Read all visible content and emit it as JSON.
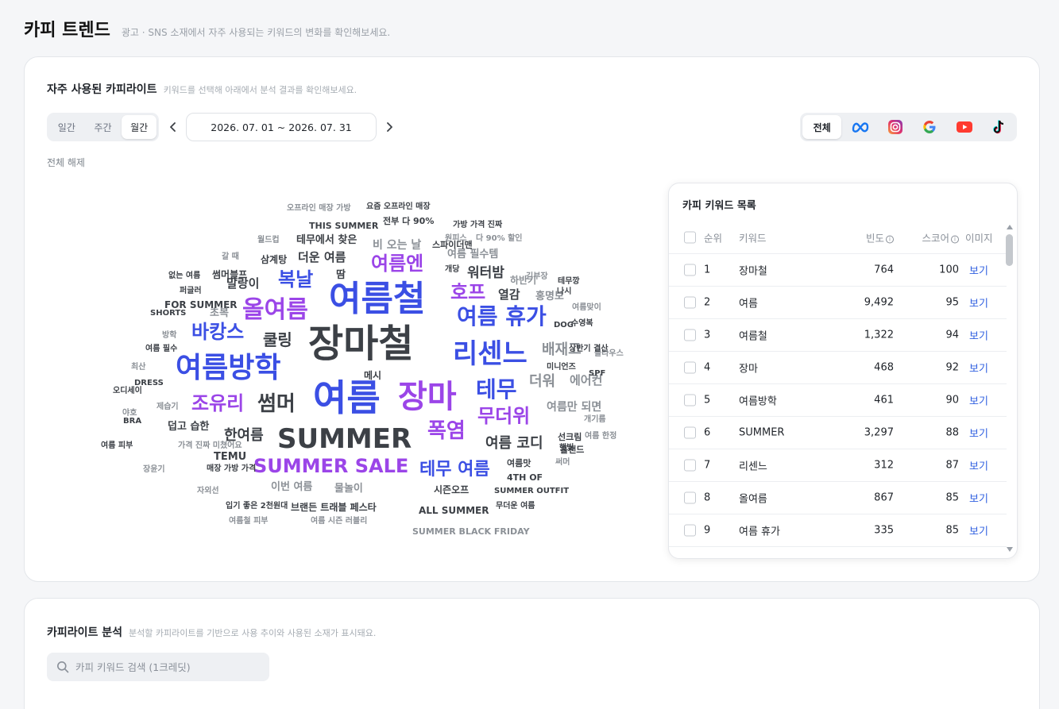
{
  "page": {
    "title": "카피 트렌드",
    "subtitle": "광고 · SNS 소재에서 자주 사용되는 키워드의 변화를 확인해보세요."
  },
  "frequent": {
    "title": "자주 사용된 카피라이트",
    "desc": "키워드를 선택해 아래에서 분석 결과를 확인해보세요.",
    "periods": [
      "일간",
      "주간",
      "월간"
    ],
    "active_period": "월간",
    "date_range": "2026. 07. 01 ~ 2026. 07. 31",
    "platforms": {
      "all": "전체",
      "icons": [
        "meta-icon",
        "instagram-icon",
        "google-icon",
        "youtube-icon",
        "tiktok-icon"
      ]
    },
    "clear_label": "전체 해제"
  },
  "colors": {
    "blue": "#3b4fe4",
    "purple": "#9b45e8",
    "dark": "#3c4046",
    "gray": "#8b9096",
    "accent": "#2f5fe0"
  },
  "wordcloud": [
    {
      "t": "장마철",
      "c": "dark"
    },
    {
      "t": "여름철",
      "c": "blue"
    },
    {
      "t": "여름",
      "c": "blue"
    },
    {
      "t": "장마",
      "c": "purple"
    },
    {
      "t": "여름방학",
      "c": "blue"
    },
    {
      "t": "SUMMER",
      "c": "dark"
    },
    {
      "t": "리센느",
      "c": "blue"
    },
    {
      "t": "올여름",
      "c": "purple"
    },
    {
      "t": "여름 휴가",
      "c": "blue"
    },
    {
      "t": "SUMMER SALE",
      "c": "purple"
    },
    {
      "t": "여름엔",
      "c": "purple"
    },
    {
      "t": "테무",
      "c": "blue"
    },
    {
      "t": "복날",
      "c": "blue"
    },
    {
      "t": "호프",
      "c": "purple"
    },
    {
      "t": "바캉스",
      "c": "blue"
    },
    {
      "t": "썸머",
      "c": "dark"
    },
    {
      "t": "조유리",
      "c": "purple"
    },
    {
      "t": "무더위",
      "c": "purple"
    },
    {
      "t": "폭염",
      "c": "purple"
    },
    {
      "t": "테무 여름",
      "c": "blue"
    },
    {
      "t": "여름 코디",
      "c": "dark"
    },
    {
      "t": "한여름",
      "c": "dark"
    },
    {
      "t": "쿨링",
      "c": "dark"
    },
    {
      "t": "배재고",
      "c": "gray"
    },
    {
      "t": "더워",
      "c": "gray"
    },
    {
      "t": "에어컨",
      "c": "gray"
    },
    {
      "t": "워터밤",
      "c": "dark"
    },
    {
      "t": "열감",
      "c": "dark"
    },
    {
      "t": "말랑이",
      "c": "dark"
    },
    {
      "t": "더운 여름",
      "c": "dark"
    },
    {
      "t": "비 오는 날",
      "c": "gray"
    },
    {
      "t": "여름만 되면",
      "c": "gray"
    },
    {
      "t": "홍명보",
      "c": "gray"
    },
    {
      "t": "여름 필수템",
      "c": "gray"
    },
    {
      "t": "테무에서 찾은",
      "c": "dark"
    },
    {
      "t": "덥고 습한",
      "c": "dark"
    },
    {
      "t": "물놀이",
      "c": "gray"
    },
    {
      "t": "이번 여름",
      "c": "gray"
    },
    {
      "t": "브랜든 트래블 페스타",
      "c": "dark"
    },
    {
      "t": "ALL SUMMER",
      "c": "dark"
    },
    {
      "t": "TEMU",
      "c": "dark"
    },
    {
      "t": "FOR SUMMER",
      "c": "dark"
    },
    {
      "t": "초복",
      "c": "gray"
    },
    {
      "t": "삼계탕",
      "c": "dark"
    },
    {
      "t": "썸머블프",
      "c": "dark"
    },
    {
      "t": "땀",
      "c": "dark"
    },
    {
      "t": "메시",
      "c": "dark"
    },
    {
      "t": "하반기",
      "c": "gray"
    },
    {
      "t": "시즌오프",
      "c": "dark"
    },
    {
      "t": "선크림",
      "c": "dark"
    },
    {
      "t": "홀랜드",
      "c": "dark"
    },
    {
      "t": "4TH OF",
      "c": "dark"
    },
    {
      "t": "여름맛",
      "c": "dark"
    },
    {
      "t": "스파이더맨",
      "c": "dark"
    },
    {
      "t": "전부 다 90%",
      "c": "dark"
    },
    {
      "t": "THIS SUMMER",
      "c": "dark"
    },
    {
      "t": "요즘 오프라인 매장",
      "c": "dark"
    },
    {
      "t": "오프라인 매장 가방",
      "c": "gray"
    },
    {
      "t": "가방 가격 진짜",
      "c": "dark"
    },
    {
      "t": "원피스",
      "c": "gray"
    },
    {
      "t": "다 90% 할인",
      "c": "gray"
    },
    {
      "t": "월드컵",
      "c": "gray"
    },
    {
      "t": "갈 때",
      "c": "gray"
    },
    {
      "t": "없는 여름",
      "c": "dark"
    },
    {
      "t": "퍼글러",
      "c": "dark"
    },
    {
      "t": "SHORTS",
      "c": "dark"
    },
    {
      "t": "방학",
      "c": "gray"
    },
    {
      "t": "여름 필수",
      "c": "dark"
    },
    {
      "t": "최산",
      "c": "gray"
    },
    {
      "t": "DRESS",
      "c": "dark"
    },
    {
      "t": "오디세이",
      "c": "dark"
    },
    {
      "t": "야호",
      "c": "gray"
    },
    {
      "t": "제습기",
      "c": "gray"
    },
    {
      "t": "BRA",
      "c": "dark"
    },
    {
      "t": "여름 피부",
      "c": "dark"
    },
    {
      "t": "가격 진짜 미쳤어요",
      "c": "gray"
    },
    {
      "t": "장윤기",
      "c": "gray"
    },
    {
      "t": "매장 가방 가격",
      "c": "dark"
    },
    {
      "t": "자외선",
      "c": "gray"
    },
    {
      "t": "입기 좋은 2천원대",
      "c": "dark"
    },
    {
      "t": "여름철 피부",
      "c": "gray"
    },
    {
      "t": "여름 시즌 러블리",
      "c": "gray"
    },
    {
      "t": "SUMMER BLACK FRIDAY",
      "c": "gray"
    },
    {
      "t": "SUMMER OUTFIT",
      "c": "dark"
    },
    {
      "t": "무더운 여름",
      "c": "dark"
    },
    {
      "t": "써머",
      "c": "gray"
    },
    {
      "t": "개기름",
      "c": "gray"
    },
    {
      "t": "햇빛",
      "c": "dark"
    },
    {
      "t": "여름 한정",
      "c": "gray"
    },
    {
      "t": "SPF",
      "c": "dark"
    },
    {
      "t": "블라우스",
      "c": "gray"
    },
    {
      "t": "미니언즈",
      "c": "dark"
    },
    {
      "t": "DOG",
      "c": "dark"
    },
    {
      "t": "상반기 결산",
      "c": "dark"
    },
    {
      "t": "여름맞이",
      "c": "gray"
    },
    {
      "t": "수영복",
      "c": "dark"
    },
    {
      "t": "나시",
      "c": "dark"
    },
    {
      "t": "테무깡",
      "c": "dark"
    },
    {
      "t": "김부장",
      "c": "gray"
    },
    {
      "t": "개당",
      "c": "dark"
    }
  ],
  "keyword_list": {
    "title": "카피 키워드 목록",
    "headers": {
      "rank": "순위",
      "keyword": "키워드",
      "freq": "빈도",
      "score": "스코어",
      "image": "이미지"
    },
    "rows": [
      {
        "rank": "1",
        "keyword": "장마철",
        "freq": "764",
        "score": "100",
        "view": "보기"
      },
      {
        "rank": "2",
        "keyword": "여름",
        "freq": "9,492",
        "score": "95",
        "view": "보기"
      },
      {
        "rank": "3",
        "keyword": "여름철",
        "freq": "1,322",
        "score": "94",
        "view": "보기"
      },
      {
        "rank": "4",
        "keyword": "장마",
        "freq": "468",
        "score": "92",
        "view": "보기"
      },
      {
        "rank": "5",
        "keyword": "여름방학",
        "freq": "461",
        "score": "90",
        "view": "보기"
      },
      {
        "rank": "6",
        "keyword": "SUMMER",
        "freq": "3,297",
        "score": "88",
        "view": "보기"
      },
      {
        "rank": "7",
        "keyword": "리센느",
        "freq": "312",
        "score": "87",
        "view": "보기"
      },
      {
        "rank": "8",
        "keyword": "올여름",
        "freq": "867",
        "score": "85",
        "view": "보기"
      },
      {
        "rank": "9",
        "keyword": "여름 휴가",
        "freq": "335",
        "score": "85",
        "view": "보기"
      }
    ]
  },
  "analysis": {
    "title": "카피라이트 분석",
    "desc": "분석할 카피라이트를 기반으로 사용 추이와 사용된 소재가 표시돼요.",
    "search_placeholder": "카피 키워드 검색 (1크레딧)"
  }
}
